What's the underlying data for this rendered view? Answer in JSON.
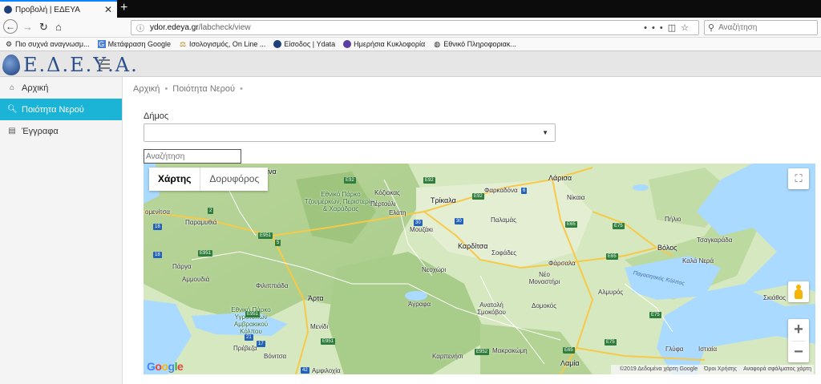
{
  "browser": {
    "tab_title": "Προβολή | ΕΔΕΥΑ",
    "url_host": "ydor.edeya.gr",
    "url_path": "/labcheck/view",
    "url_prefix": "",
    "search_placeholder": "Αναζήτηση",
    "bookmarks": [
      {
        "label": "Πιο συχνά αναγνωσμ...",
        "icon": "gear-icon"
      },
      {
        "label": "Μετάφραση Google",
        "icon": "translate-icon"
      },
      {
        "label": "Ισολογισμός, On Line ...",
        "icon": "scales-icon"
      },
      {
        "label": "Είσοδος | Ydata",
        "icon": "site-icon"
      },
      {
        "label": "Ημερήσια Κυκλοφορία",
        "icon": "site-icon"
      },
      {
        "label": "Εθνικό Πληροφοριακ...",
        "icon": "globe-icon"
      }
    ]
  },
  "site": {
    "logo_text": "Ε.Δ.Ε.Υ.Α."
  },
  "sidebar": {
    "items": [
      {
        "label": "Αρχική",
        "icon": "home-icon",
        "active": false
      },
      {
        "label": "Ποιότητα Νερού",
        "icon": "search-icon",
        "active": true
      },
      {
        "label": "Έγγραφα",
        "icon": "book-icon",
        "active": false
      }
    ]
  },
  "main": {
    "breadcrumb": [
      "Αρχική",
      "Ποιότητα Νερού"
    ],
    "municipality_label": "Δήμος",
    "municipality_value": "",
    "map_search_placeholder": "Αναζήτηση"
  },
  "map": {
    "types": [
      "Χάρτης",
      "Δορυφόρος"
    ],
    "active_type": "Χάρτης",
    "attribution": [
      "©2019 Δεδομένα χάρτη Google",
      "Όροι Χρήσης",
      "Αναφορά σφάλματος χάρτη"
    ],
    "labels": {
      "ioannina": "ννινα",
      "larisa": "Λάρισα",
      "kozani": "Κόζιακας",
      "trikala": "Τρίκαλα",
      "farkadona": "Φαρκαδόνα",
      "nikaia": "Νίκαια",
      "park": "Εθνικό Πάρκο Τζουμέρκων, Περιστερίου & Χαράδρας",
      "pertouli": "Περτούλι",
      "elati": "Ελάτη",
      "igoumenitsa": "ομενίτσα",
      "paramythia": "Παραμυθιά",
      "mouzaki": "Μουζάκι",
      "palamas": "Παλαμάς",
      "pilio": "Πήλιο",
      "tsagarada": "Τσαγκαράδα",
      "karditsa": "Καρδίτσα",
      "sofades": "Σοφάδες",
      "volos": "Βόλος",
      "farsala": "Φάρσαλα",
      "nea_anchialos": "Καλά Νερά",
      "parga": "Πάργα",
      "neochori": "Νεοχώρι",
      "nea_monastiri": "Νέο Μοναστήρι",
      "pagasitikos": "Παγασητικός Κόλπος",
      "ammoudia": "Αμμουδιά",
      "filippiada": "Φιλιππιάδα",
      "almyros": "Αλμυρός",
      "skiathos": "Σκιάθος",
      "arta": "Άρτα",
      "agrafa": "Άγραφα",
      "anatoli": "Ανατολή Σμοκόβου",
      "domokos": "Δομοκός",
      "amvrakikos_park": "Εθνικό Πάρκο Υγροτόπων Αμβρακικού Κόλπου",
      "menidi": "Μενίδι",
      "preveza": "Πρέβεζα",
      "vonitsa": "Βόνιτσα",
      "karpenisi": "Καρπενήσι",
      "makrakomi": "Μακρακώμη",
      "lamia": "Λαμία",
      "glyfa": "Γλύφα",
      "istiaia": "Ιστιαία",
      "amfilochia": "Αμφιλοχία"
    },
    "road_shields": [
      "E92",
      "E92",
      "6",
      "E92",
      "30",
      "30",
      "E65",
      "E75",
      "E951",
      "5",
      "E951",
      "E65",
      "E75",
      "E951",
      "21",
      "17",
      "E951",
      "42",
      "E952",
      "E65",
      "E75",
      "18",
      "2",
      "18"
    ]
  }
}
